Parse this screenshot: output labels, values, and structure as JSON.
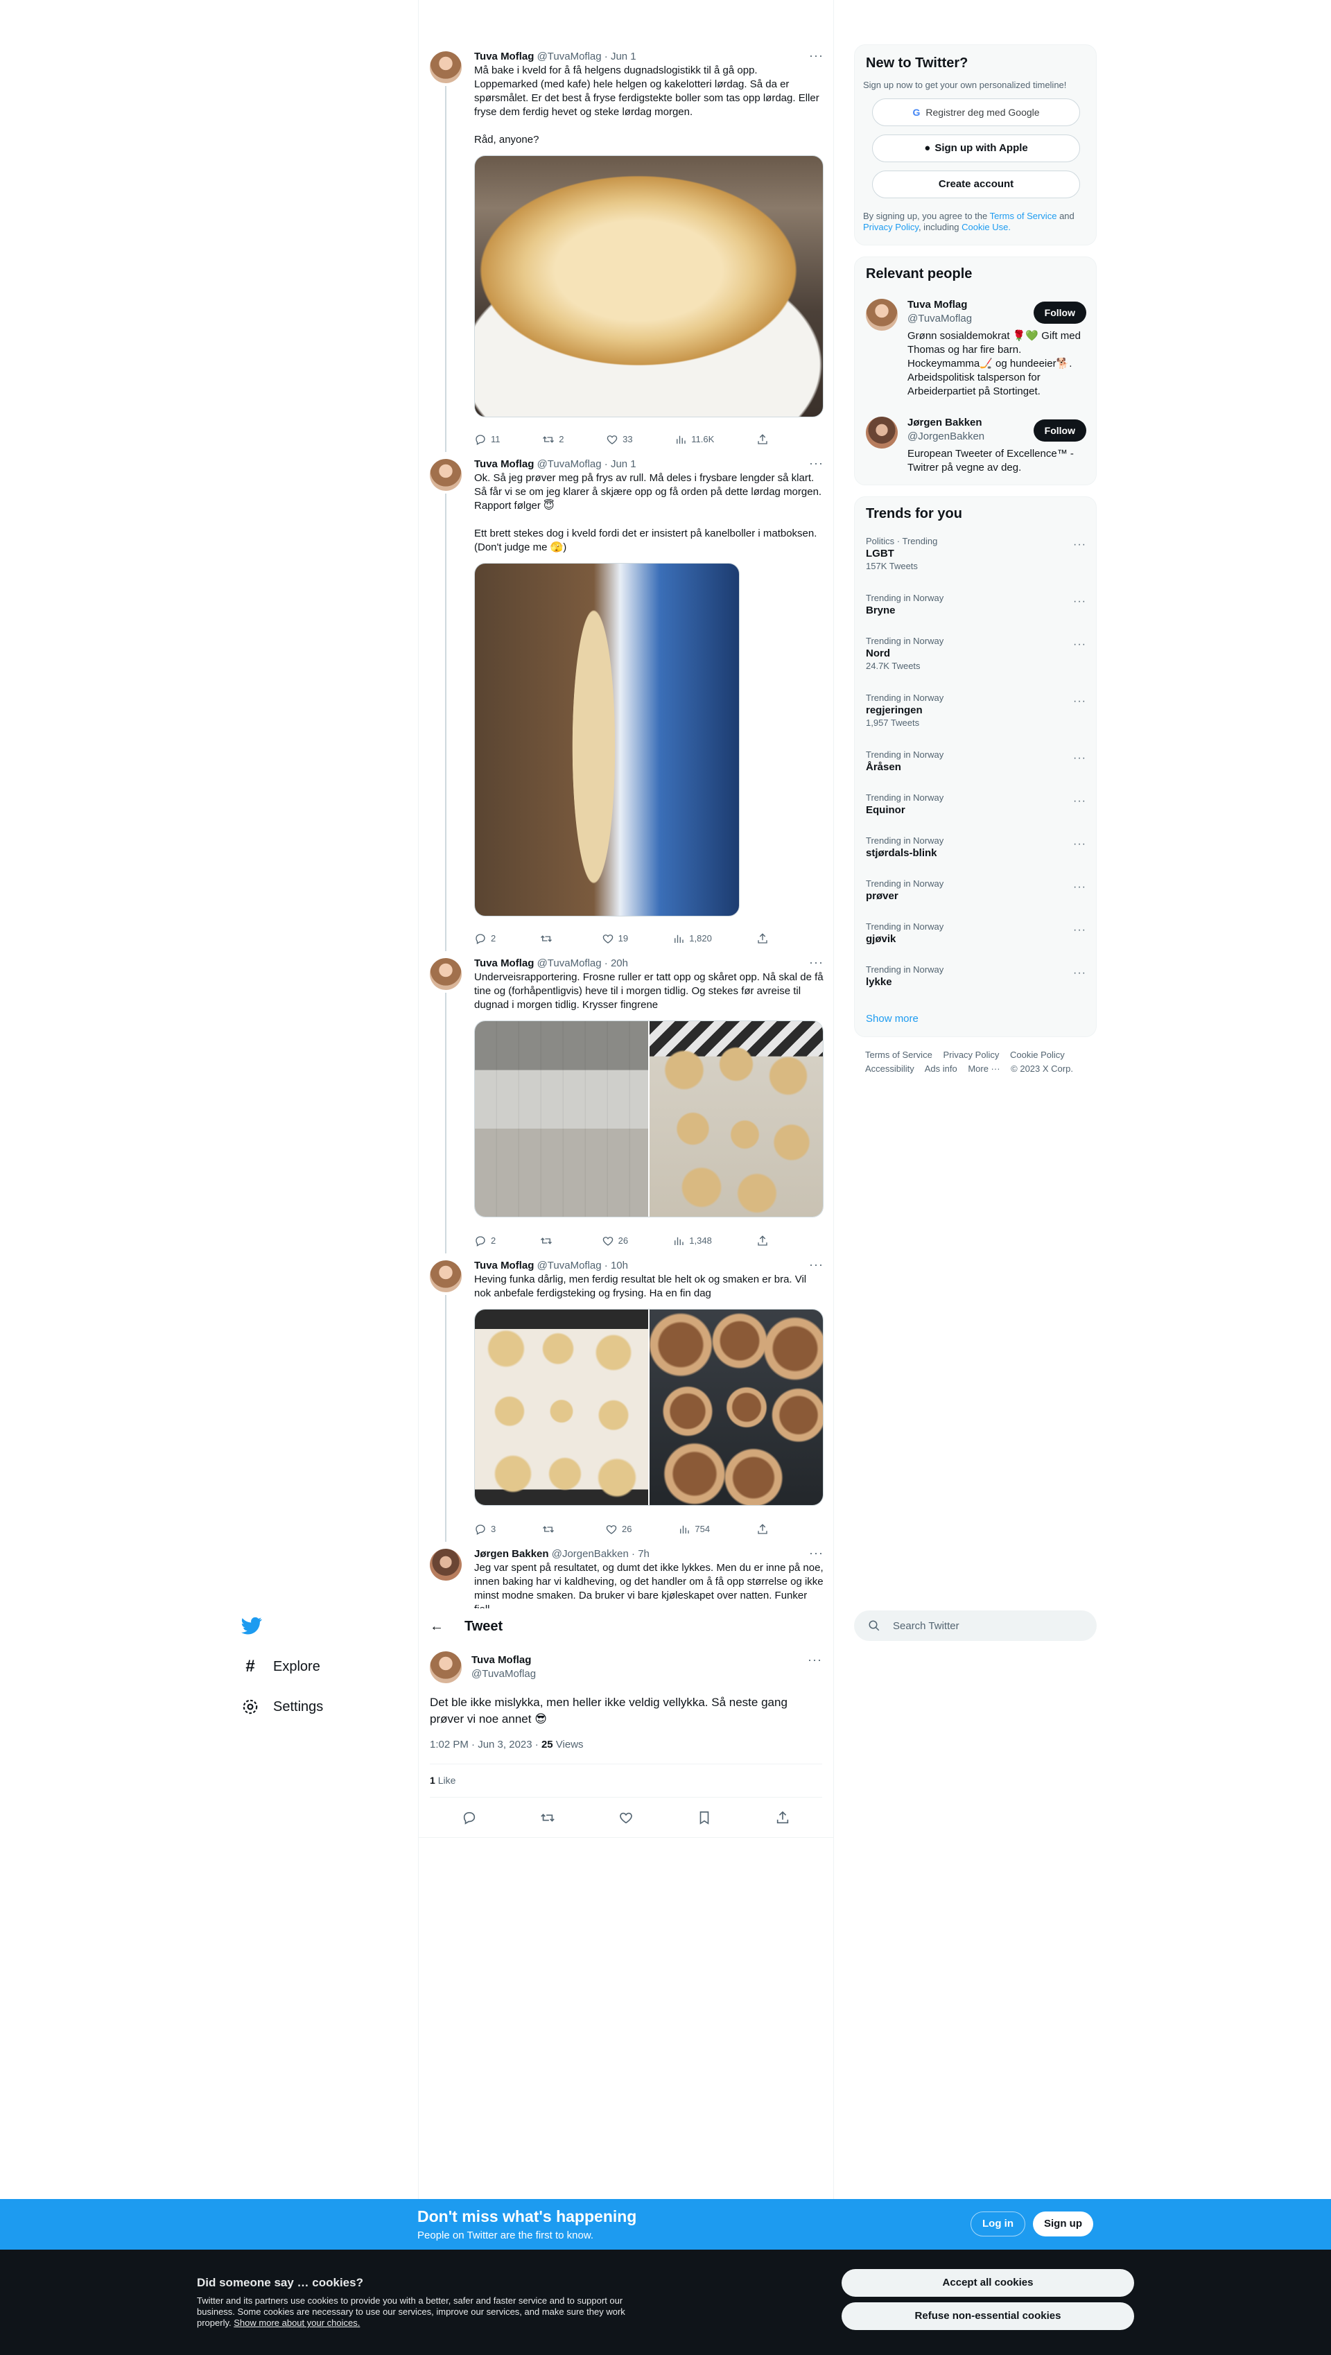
{
  "thread": [
    {
      "name": "Tuva Moflag",
      "handle": "@TuvaMoflag",
      "date": "Jun 1",
      "text": "Må bake i kveld for å få helgens dugnadslogistikk til å gå opp. Loppemarked (med kafe) hele helgen og kakelotteri lørdag. Så da er spørsmålet. Er det best å fryse ferdigstekte boller som tas opp lørdag. Eller fryse dem ferdig hevet og steke lørdag morgen.\n\nRåd, anyone?",
      "replies": "11",
      "retweets": "2",
      "likes": "33",
      "views": "11.6K"
    },
    {
      "name": "Tuva Moflag",
      "handle": "@TuvaMoflag",
      "date": "Jun 1",
      "text": "Ok. Så jeg prøver meg på frys av rull. Må deles i frysbare lengder så klart. Så får vi se om jeg klarer å skjære opp og få orden på dette lørdag morgen. Rapport følger 😇\n\nEtt brett stekes dog i kveld fordi det er insistert på kanelboller i matboksen. (Don't judge me 🫣)",
      "replies": "2",
      "retweets": "",
      "likes": "19",
      "views": "1,820"
    },
    {
      "name": "Tuva Moflag",
      "handle": "@TuvaMoflag",
      "date": "20h",
      "text": "Underveisrapportering. Frosne ruller er tatt opp og skåret opp. Nå skal de få tine og (forhåpentligvis) heve til i morgen tidlig. Og stekes før avreise til dugnad i morgen tidlig. Krysser fingrene",
      "replies": "2",
      "retweets": "",
      "likes": "26",
      "views": "1,348"
    },
    {
      "name": "Tuva Moflag",
      "handle": "@TuvaMoflag",
      "date": "10h",
      "text": "Heving funka dårlig, men ferdig resultat ble helt ok og smaken er bra. Vil nok anbefale ferdigsteking og frysing. Ha en fin dag",
      "replies": "3",
      "retweets": "",
      "likes": "26",
      "views": "754"
    },
    {
      "name": "Jørgen Bakken",
      "handle": "@JorgenBakken",
      "date": "7h",
      "text": "Jeg var spent på resultatet, og dumt det ikke lykkes. Men du er inne på noe, innen baking har vi kaldheving, og det handler om å få opp størrelse og ikke minst modne smaken. Da bruker vi bare kjøleskapet over natten. Funker fjell"
    }
  ],
  "nav": {
    "explore": "Explore",
    "settings": "Settings"
  },
  "main_tweet": {
    "header": "Tweet",
    "name": "Tuva Moflag",
    "handle": "@TuvaMoflag",
    "text": "Det ble ikke mislykka, men heller ikke veldig vellykka. Så neste gang prøver vi noe annet 😎",
    "time": "1:02 PM · Jun 3, 2023",
    "views_count": "25",
    "views_label": "Views",
    "likes_count": "1",
    "likes_label": "Like"
  },
  "new_to_twitter": {
    "title": "New to Twitter?",
    "subtitle": "Sign up now to get your own personalized timeline!",
    "google": "Registrer deg med Google",
    "apple": "Sign up with Apple",
    "create": "Create account",
    "legal_1": "By signing up, you agree to the",
    "tos": "Terms of Service",
    "and": "and",
    "privacy": "Privacy Policy",
    "including": ", including",
    "cookie": "Cookie Use."
  },
  "relevant_people": {
    "title": "Relevant people",
    "follow_label": "Follow",
    "people": [
      {
        "name": "Tuva Moflag",
        "handle": "@TuvaMoflag",
        "bio": "Grønn sosialdemokrat 🌹💚 Gift med Thomas og har fire barn. Hockeymamma🏒 og hundeeier🐕. Arbeidspolitisk talsperson for Arbeiderpartiet på Stortinget."
      },
      {
        "name": "Jørgen Bakken",
        "handle": "@JorgenBakken",
        "bio": "European Tweeter of Excellence™ - Twitrer på vegne av deg."
      }
    ]
  },
  "trends": {
    "title": "Trends for you",
    "items": [
      {
        "context": "Politics · Trending",
        "name": "LGBT",
        "count": "157K Tweets"
      },
      {
        "context": "Trending in Norway",
        "name": "Bryne",
        "count": ""
      },
      {
        "context": "Trending in Norway",
        "name": "Nord",
        "count": "24.7K Tweets"
      },
      {
        "context": "Trending in Norway",
        "name": "regjeringen",
        "count": "1,957 Tweets"
      },
      {
        "context": "Trending in Norway",
        "name": "Åråsen",
        "count": ""
      },
      {
        "context": "Trending in Norway",
        "name": "Equinor",
        "count": ""
      },
      {
        "context": "Trending in Norway",
        "name": "stjørdals-blink",
        "count": ""
      },
      {
        "context": "Trending in Norway",
        "name": "prøver",
        "count": ""
      },
      {
        "context": "Trending in Norway",
        "name": "gjøvik",
        "count": ""
      },
      {
        "context": "Trending in Norway",
        "name": "lykke",
        "count": ""
      }
    ],
    "show_more": "Show more"
  },
  "footer": {
    "tos": "Terms of Service",
    "privacy": "Privacy Policy",
    "cookie": "Cookie Policy",
    "accessibility": "Accessibility",
    "ads": "Ads info",
    "more": "More ···",
    "copyright": "© 2023 X Corp."
  },
  "search": {
    "placeholder": "Search Twitter"
  },
  "banner": {
    "headline": "Don't miss what's happening",
    "sub": "People on Twitter are the first to know.",
    "login": "Log in",
    "signup": "Sign up"
  },
  "cookies": {
    "title": "Did someone say … cookies?",
    "body": "Twitter and its partners use cookies to provide you with a better, safer and faster service and to support our business. Some cookies are necessary to use our services, improve our services, and make sure they work properly.",
    "link": "Show more about your choices.",
    "accept": "Accept all cookies",
    "refuse": "Refuse non-essential cookies"
  },
  "colors": {
    "accent": "#1d9bf0",
    "text": "#0f1419",
    "muted": "#536471",
    "cookie_bg": "#0f1419"
  }
}
